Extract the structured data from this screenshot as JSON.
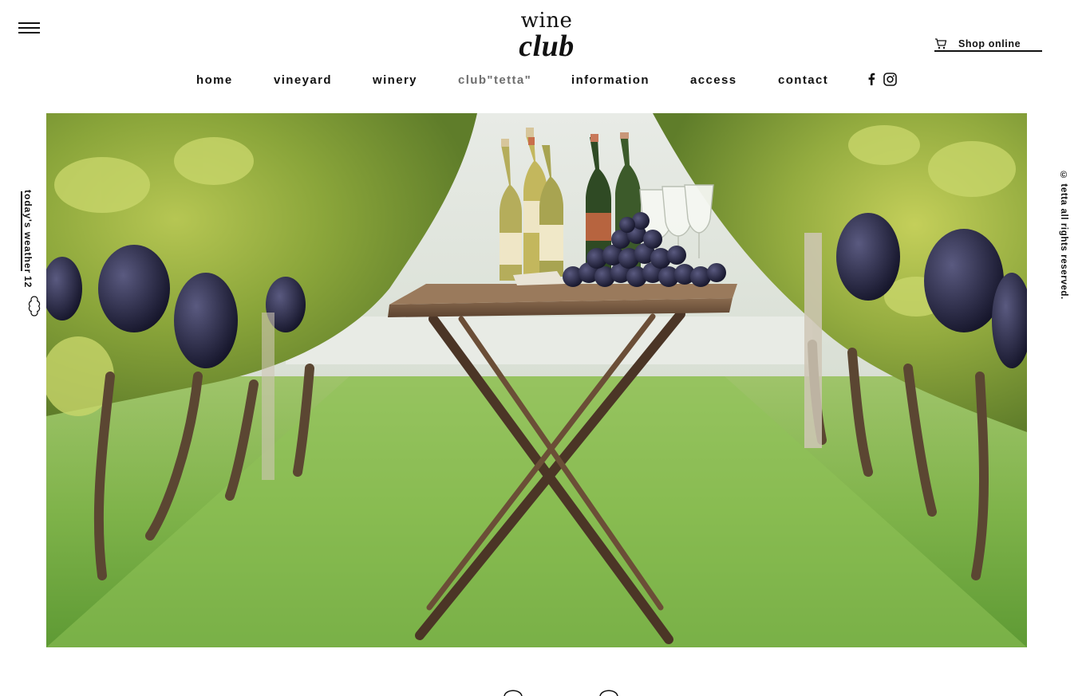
{
  "header": {
    "logo": {
      "top": "wine",
      "bottom": "club"
    },
    "shop": {
      "label": "Shop online",
      "icon": "cart-icon"
    },
    "menu_icon": "hamburger-icon"
  },
  "nav": {
    "items": [
      {
        "label": "home",
        "active": false
      },
      {
        "label": "vineyard",
        "active": false
      },
      {
        "label": "winery",
        "active": false
      },
      {
        "label": "club\"tetta\"",
        "active": true
      },
      {
        "label": "information",
        "active": false
      },
      {
        "label": "access",
        "active": false
      },
      {
        "label": "contact",
        "active": false
      }
    ],
    "social": [
      "facebook-icon",
      "instagram-icon"
    ]
  },
  "side": {
    "weather_label": "today's weather",
    "weather_value": "12",
    "weather_icon": "cloud-icon",
    "copyright": "© tetta all rights reserved."
  },
  "hero": {
    "image": "vineyard-table-with-wine-bottles-and-grapes"
  },
  "colors": {
    "text": "#111111",
    "active_nav": "#6e6e6e",
    "background": "#ffffff"
  }
}
